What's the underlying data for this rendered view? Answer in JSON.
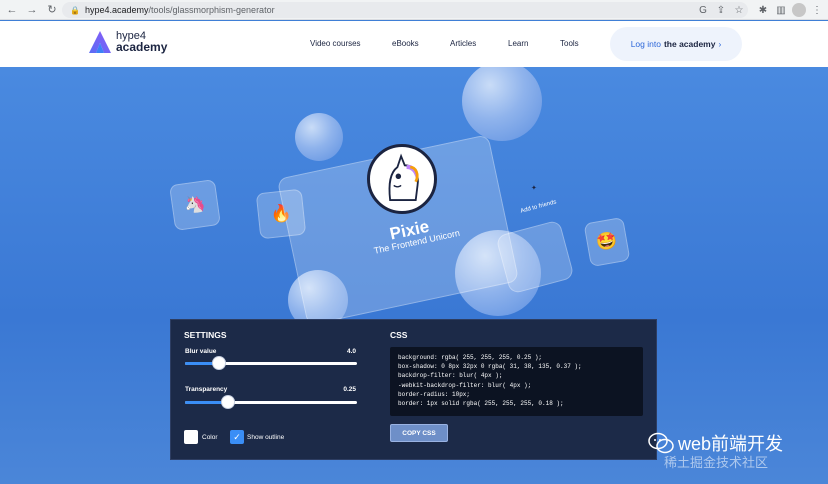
{
  "browser": {
    "url_host": "hype4.academy",
    "url_path": "/tools/glassmorphism-generator"
  },
  "header": {
    "logo_line1": "hype4",
    "logo_line2": "academy",
    "nav": [
      "Video courses",
      "eBooks",
      "Articles",
      "Learn",
      "Tools"
    ],
    "login_prefix": "Log into",
    "login_emph": "the academy",
    "login_arrow": "›"
  },
  "preview": {
    "name": "Pixie",
    "subtitle": "The Frontend Unicorn",
    "friends_label": "Add to friends",
    "emoji_unicorn": "🦄",
    "emoji_fire": "🔥",
    "emoji_star_face": "🤩"
  },
  "settings": {
    "title": "SETTINGS",
    "blur_label": "Blur value",
    "blur_value": "4.0",
    "blur_fraction": 0.2,
    "transparency_label": "Transparency",
    "transparency_value": "0.25",
    "transparency_fraction": 0.25,
    "color_label": "Color",
    "outline_label": "Show outline",
    "outline_checked": true
  },
  "css": {
    "title": "CSS",
    "lines": [
      "background: rgba( 255, 255, 255, 0.25 );",
      "box-shadow: 0 8px 32px 0 rgba( 31, 38, 135, 0.37 );",
      "backdrop-filter: blur( 4px );",
      "-webkit-backdrop-filter: blur( 4px );",
      "border-radius: 10px;",
      "border: 1px solid rgba( 255, 255, 255, 0.18 );"
    ],
    "copy_label": "COPY CSS"
  },
  "watermark": {
    "title": "web前端开发",
    "sub": "稀土掘金技术社区"
  },
  "colors": {
    "accent": "#3a8ef6",
    "panel": "#1c2a48",
    "hero": "#3f7fd6"
  }
}
